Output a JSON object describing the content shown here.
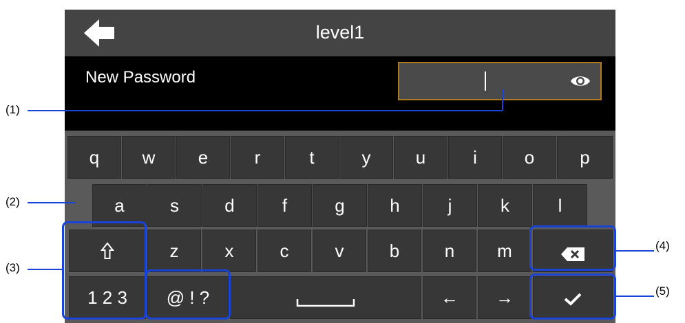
{
  "title": "level1",
  "password": {
    "label": "New Password",
    "value": ""
  },
  "keyboard": {
    "row1": [
      "q",
      "w",
      "e",
      "r",
      "t",
      "y",
      "u",
      "i",
      "o",
      "p"
    ],
    "row2": [
      "a",
      "s",
      "d",
      "f",
      "g",
      "h",
      "j",
      "k",
      "l"
    ],
    "row3": [
      "z",
      "x",
      "c",
      "v",
      "b",
      "n",
      "m"
    ],
    "numbers_key": "1 2 3",
    "symbols_key": "@ ! ?",
    "shift_symbol": "⇧",
    "left_arrow": "←",
    "right_arrow": "→"
  },
  "callouts": [
    "(1)",
    "(2)",
    "(3)",
    "(4)",
    "(5)"
  ],
  "colors": {
    "title_bar": "#444444",
    "screen_bg": "#000000",
    "keyboard_bg": "#5a5a5a",
    "key_bg": "#373737",
    "field_border": "#b07a1e",
    "callout": "#1a43d8"
  },
  "icons": {
    "back": "back-arrow-icon",
    "reveal": "eye-icon",
    "shift": "shift-icon",
    "space": "space-icon",
    "backspace": "backspace-icon",
    "enter": "checkmark-icon"
  }
}
